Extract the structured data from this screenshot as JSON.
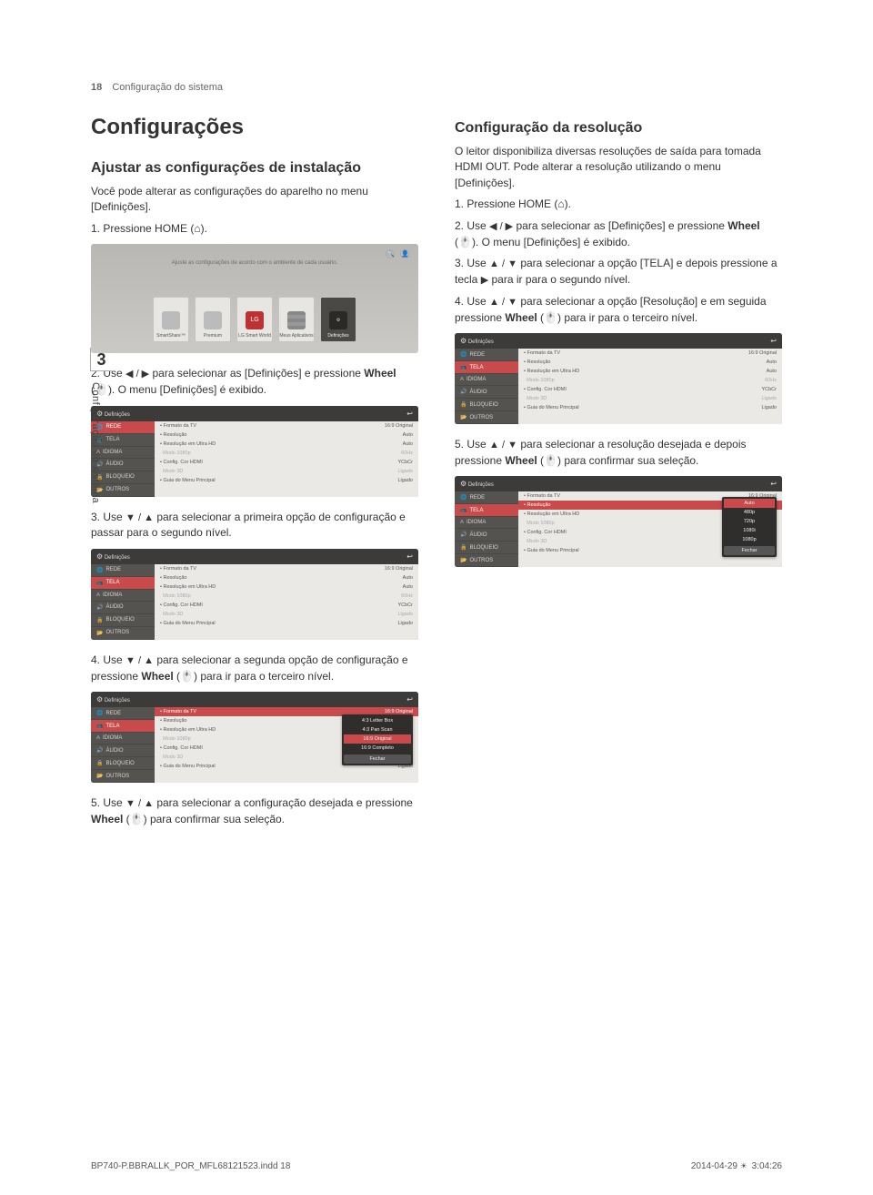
{
  "header": {
    "page_num": "18",
    "section": "Configuração do sistema"
  },
  "tab": {
    "number": "3",
    "label": "Configuração do sistema"
  },
  "left": {
    "h1": "Configurações",
    "h2": "Ajustar as configurações de instalação",
    "intro": "Você pode alterar as configurações do aparelho no menu [Definições].",
    "steps": {
      "s1": {
        "num": "1.",
        "t": "Pressione HOME (",
        "t2": ")."
      },
      "s2": {
        "num": "2.",
        "a": "Use ",
        "arrows": "◀ / ▶",
        "b": " para selecionar as [Definições] e pressione ",
        "wheel": "Wheel",
        "c": " (🖱️). O menu [Definições] é exibido."
      },
      "s3": {
        "num": "3.",
        "a": "Use ",
        "arrows": "▼ / ▲",
        "b": " para selecionar a primeira opção de configuração e passar para o segundo nível."
      },
      "s4": {
        "num": "4.",
        "a": "Use ",
        "arrows": "▼ / ▲",
        "b": " para selecionar a segunda opção de configuração e pressione ",
        "wheel": "Wheel",
        "c": " (🖱️) para ir para o terceiro nível."
      },
      "s5": {
        "num": "5.",
        "a": "Use ",
        "arrows": "▼ / ▲",
        "b": " para selecionar a configuração desejada e pressione ",
        "wheel": "Wheel",
        "c": " (🖱️) para confirmar sua seleção."
      }
    }
  },
  "right": {
    "h2": "Configuração da resolução",
    "intro": "O leitor disponibiliza diversas resoluções de saída para tomada HDMI OUT. Pode alterar a resolução utilizando o menu [Definições].",
    "steps": {
      "s1": {
        "num": "1.",
        "t": "Pressione HOME (",
        "t2": ")."
      },
      "s2": {
        "num": "2.",
        "a": "Use ",
        "arrows": "◀ / ▶",
        "b": " para selecionar as [Definições] e pressione ",
        "wheel": "Wheel",
        "c": " (🖱️). O menu [Definições] é exibido."
      },
      "s3": {
        "num": "3.",
        "a": "Use ",
        "arrows": "▲ / ▼",
        "b": " para selecionar a opção [TELA] e depois pressione a tecla ",
        "play": "▶",
        "c": " para ir para o segundo nível."
      },
      "s4": {
        "num": "4.",
        "a": "Use ",
        "arrows": "▲ / ▼",
        "b": " para selecionar a opção [Resolução] e em seguida pressione ",
        "wheel": "Wheel",
        "c": " (🖱️) para ir para o terceiro nível."
      },
      "s5": {
        "num": "5.",
        "a": "Use ",
        "arrows": "▲ / ▼",
        "b": " para selecionar a resolução desejada e depois pressione ",
        "wheel": "Wheel",
        "c": " (🖱️) para confirmar sua seleção."
      }
    }
  },
  "home_shot": {
    "caption": "Ajuste as configurações de acordo com o ambiente de cada usuário.",
    "tiles": [
      {
        "label": "SmartShare™"
      },
      {
        "label": "Premium"
      },
      {
        "label": "LG Smart World"
      },
      {
        "label": "Meus Aplicativos"
      },
      {
        "label": "Definições",
        "selected": true
      }
    ],
    "topicons": {
      "search": "🔍",
      "user": "👤"
    }
  },
  "menu_shot": {
    "title": "Definições",
    "gear": "⚙",
    "back": "↩",
    "side_items": [
      {
        "icon": "🌐",
        "label": "REDE"
      },
      {
        "icon": "📺",
        "label": "TELA"
      },
      {
        "icon": "A",
        "label": "IDIOMA"
      },
      {
        "icon": "🔊",
        "label": "ÁUDIO"
      },
      {
        "icon": "🔒",
        "label": "BLOQUEIO"
      },
      {
        "icon": "📂",
        "label": "OUTROS"
      }
    ],
    "rows": [
      {
        "k": "Formato da TV",
        "v": "16:9 Original"
      },
      {
        "k": "Resolução",
        "v": "Auto"
      },
      {
        "k": "Resolução em Ultra HD",
        "v": "Auto"
      },
      {
        "k": "Modo 1080p",
        "v": "60Hz",
        "dim": true
      },
      {
        "k": "Config. Cor HDMI",
        "v": "YCbCr"
      },
      {
        "k": "Modo 3D",
        "v": "Ligado",
        "dim": true
      },
      {
        "k": "Guia do Menu Principal",
        "v": "Ligado"
      }
    ]
  },
  "aspect_popup": {
    "options": [
      {
        "label": "4:3 Letter Box"
      },
      {
        "label": "4:3 Pan Scan"
      },
      {
        "label": "16:9 Original",
        "selected": true
      },
      {
        "label": "16:9 Completo"
      }
    ],
    "close": "Fechar"
  },
  "res_popup": {
    "options": [
      {
        "label": "Auto",
        "selected": true
      },
      {
        "label": "480p"
      },
      {
        "label": "720p"
      },
      {
        "label": "1080i"
      },
      {
        "label": "1080p"
      }
    ],
    "close": "Fechar"
  },
  "footer": {
    "file": "BP740-P.BBRALLK_POR_MFL68121523.indd   18",
    "date": "2014-04-29   ",
    "sun": "☀",
    "time": " 3:04:26"
  },
  "icons": {
    "home_glyph": "⌂",
    "wheel_glyph": "🖱️"
  },
  "chart_data": null
}
